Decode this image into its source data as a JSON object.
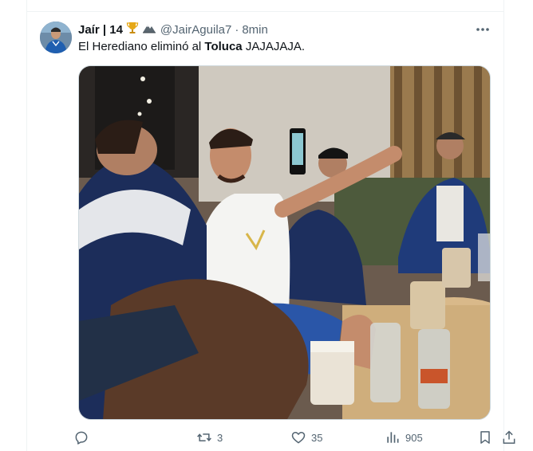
{
  "tweet": {
    "author_name": "Jaír | 14",
    "handle": "@JairAguila7",
    "separator": "·",
    "time": "8min",
    "text_before": "El Herediano eliminó al ",
    "text_bold": "Toluca",
    "text_after": " JAJAJAJA."
  },
  "actions": {
    "reply_count": "",
    "retweet_count": "3",
    "like_count": "35",
    "views_count": "905"
  },
  "icons": {
    "more": "more-dots-icon",
    "reply": "reply-icon",
    "retweet": "retweet-icon",
    "like": "heart-icon",
    "views": "views-chart-icon",
    "bookmark": "bookmark-icon",
    "share": "share-icon",
    "badges": [
      "trophy-icon",
      "mountain-icon"
    ]
  },
  "colors": {
    "text_primary": "#0f1419",
    "text_secondary": "#536471",
    "border": "#eff3f4",
    "trophy": "#e6a817"
  }
}
